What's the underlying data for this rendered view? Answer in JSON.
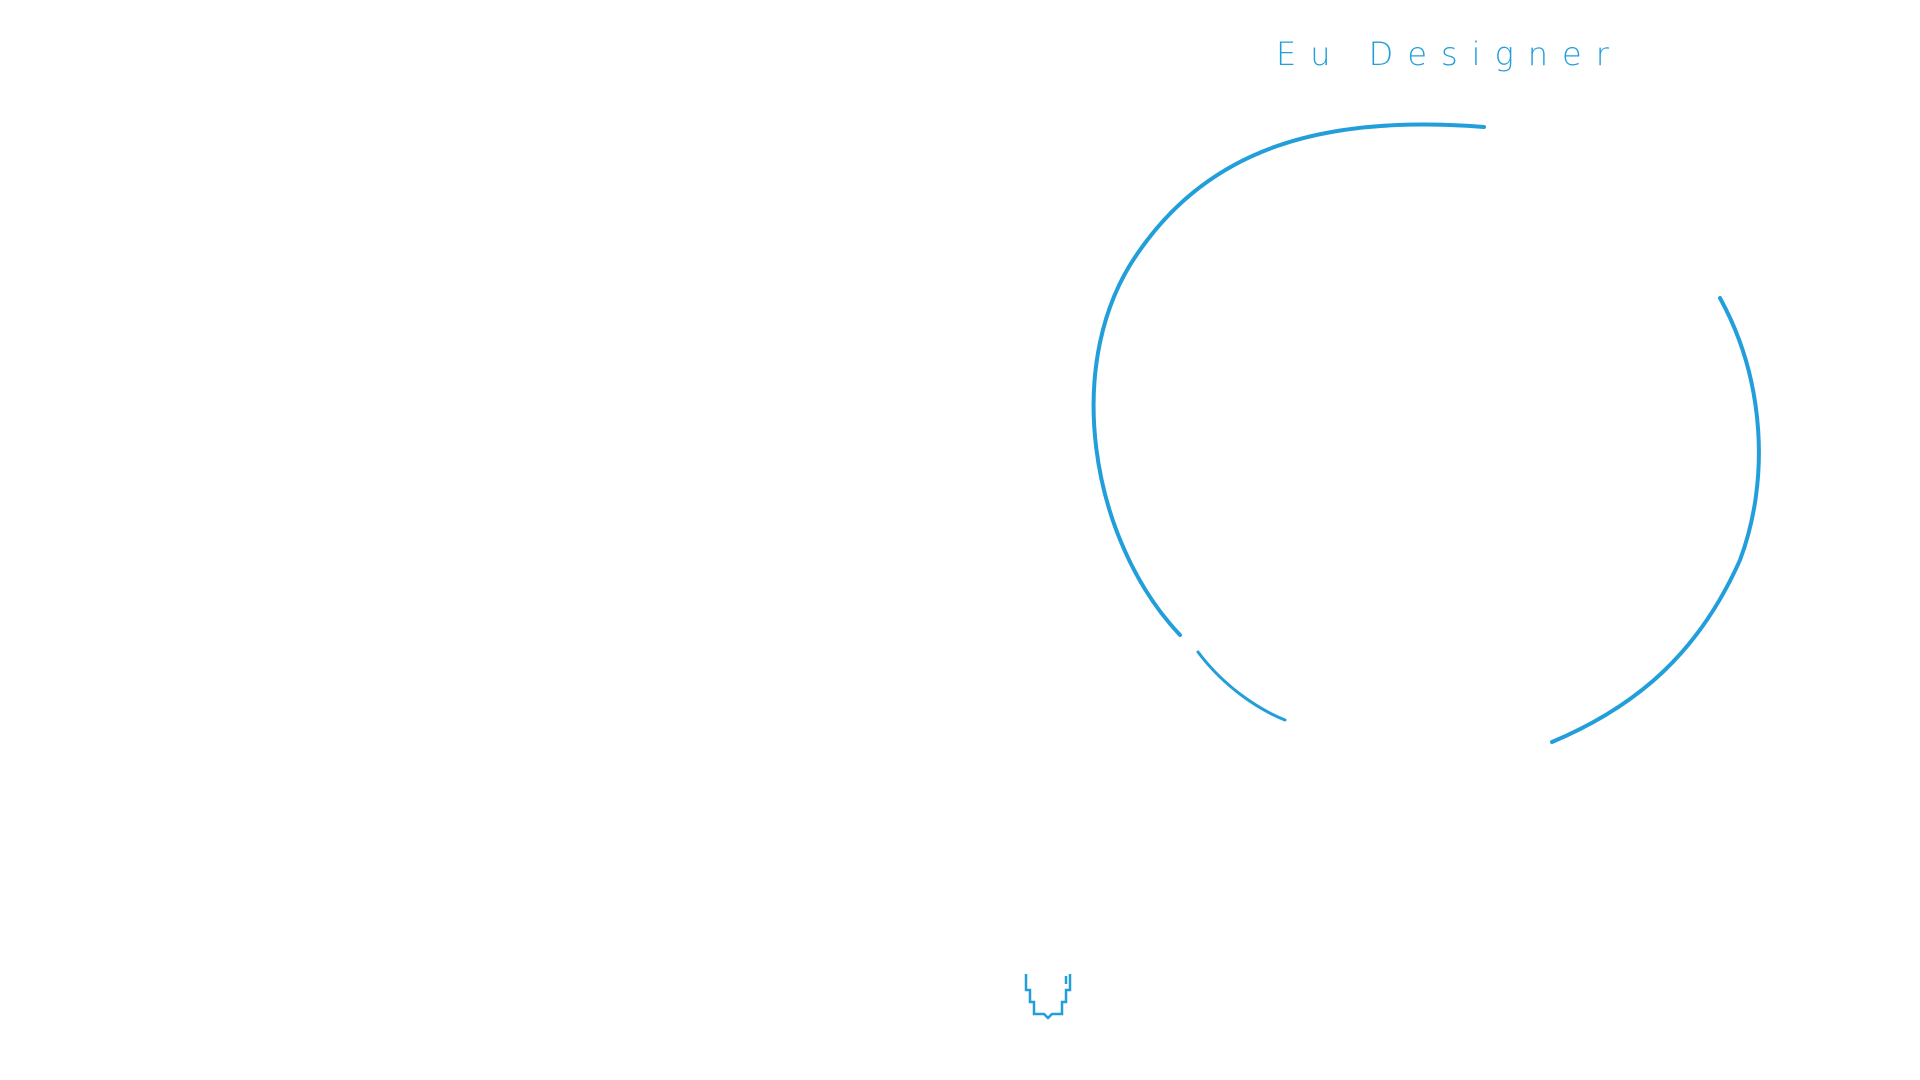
{
  "brand": {
    "title": "Eu Designer",
    "accent_color": "#229FDA"
  },
  "decor": {
    "ring_icon": "broken-circle-icon",
    "logo_icon": "monogram-u-icon"
  }
}
